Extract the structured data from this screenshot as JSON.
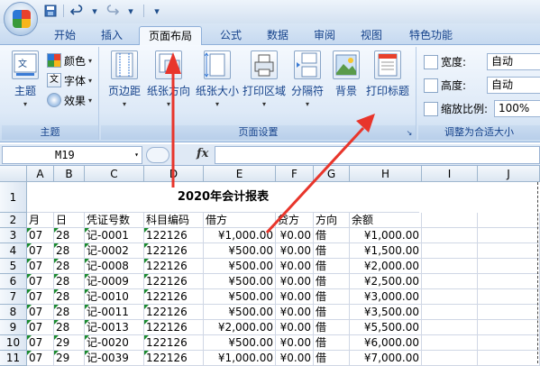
{
  "qat": {
    "save": "save-icon",
    "undo": "undo-icon",
    "redo": "redo-icon",
    "customize": "▾"
  },
  "tabs": [
    "开始",
    "插入",
    "页面布局",
    "公式",
    "数据",
    "审阅",
    "视图",
    "特色功能"
  ],
  "ribbon": {
    "theme_group": {
      "label": "主题",
      "theme_button": "主题",
      "colors": "颜色",
      "fonts": "字体",
      "effects": "效果"
    },
    "page_setup_group": {
      "label": "页面设置",
      "margins": "页边距",
      "orientation": "纸张方向",
      "size": "纸张大小",
      "print_area": "打印区域",
      "breaks": "分隔符",
      "background": "背景",
      "print_titles": "打印标题"
    },
    "scale_group": {
      "label": "调整为合适大小",
      "width_label": "宽度:",
      "width_value": "自动",
      "height_label": "高度:",
      "height_value": "自动",
      "scale_label": "缩放比例:",
      "scale_value": "100%"
    }
  },
  "formula_bar": {
    "name_box": "M19",
    "fx": "fx",
    "formula": ""
  },
  "sheet": {
    "columns": [
      "A",
      "B",
      "C",
      "D",
      "E",
      "F",
      "G",
      "H",
      "I",
      "J"
    ],
    "rows": [
      "1",
      "2",
      "3",
      "4",
      "5",
      "6",
      "7",
      "8",
      "9",
      "10",
      "11"
    ],
    "title": "2020年会计报表",
    "headers": [
      "月",
      "日",
      "凭证号数",
      "科目编码",
      "借方",
      "贷方",
      "方向",
      "余额"
    ],
    "data": [
      [
        "07",
        "28",
        "记-0001",
        "122126",
        "¥1,000.00",
        "¥0.00",
        "借",
        "¥1,000.00"
      ],
      [
        "07",
        "28",
        "记-0002",
        "122126",
        "¥500.00",
        "¥0.00",
        "借",
        "¥1,500.00"
      ],
      [
        "07",
        "28",
        "记-0008",
        "122126",
        "¥500.00",
        "¥0.00",
        "借",
        "¥2,000.00"
      ],
      [
        "07",
        "28",
        "记-0009",
        "122126",
        "¥500.00",
        "¥0.00",
        "借",
        "¥2,500.00"
      ],
      [
        "07",
        "28",
        "记-0010",
        "122126",
        "¥500.00",
        "¥0.00",
        "借",
        "¥3,000.00"
      ],
      [
        "07",
        "28",
        "记-0011",
        "122126",
        "¥500.00",
        "¥0.00",
        "借",
        "¥3,500.00"
      ],
      [
        "07",
        "28",
        "记-0013",
        "122126",
        "¥2,000.00",
        "¥0.00",
        "借",
        "¥5,500.00"
      ],
      [
        "07",
        "29",
        "记-0020",
        "122126",
        "¥500.00",
        "¥0.00",
        "借",
        "¥6,000.00"
      ],
      [
        "07",
        "29",
        "记-0039",
        "122126",
        "¥1,000.00",
        "¥0.00",
        "借",
        "¥7,000.00"
      ]
    ]
  },
  "colors": {
    "annotation_arrow": "#e8352b",
    "tab_text": "#15428b"
  }
}
